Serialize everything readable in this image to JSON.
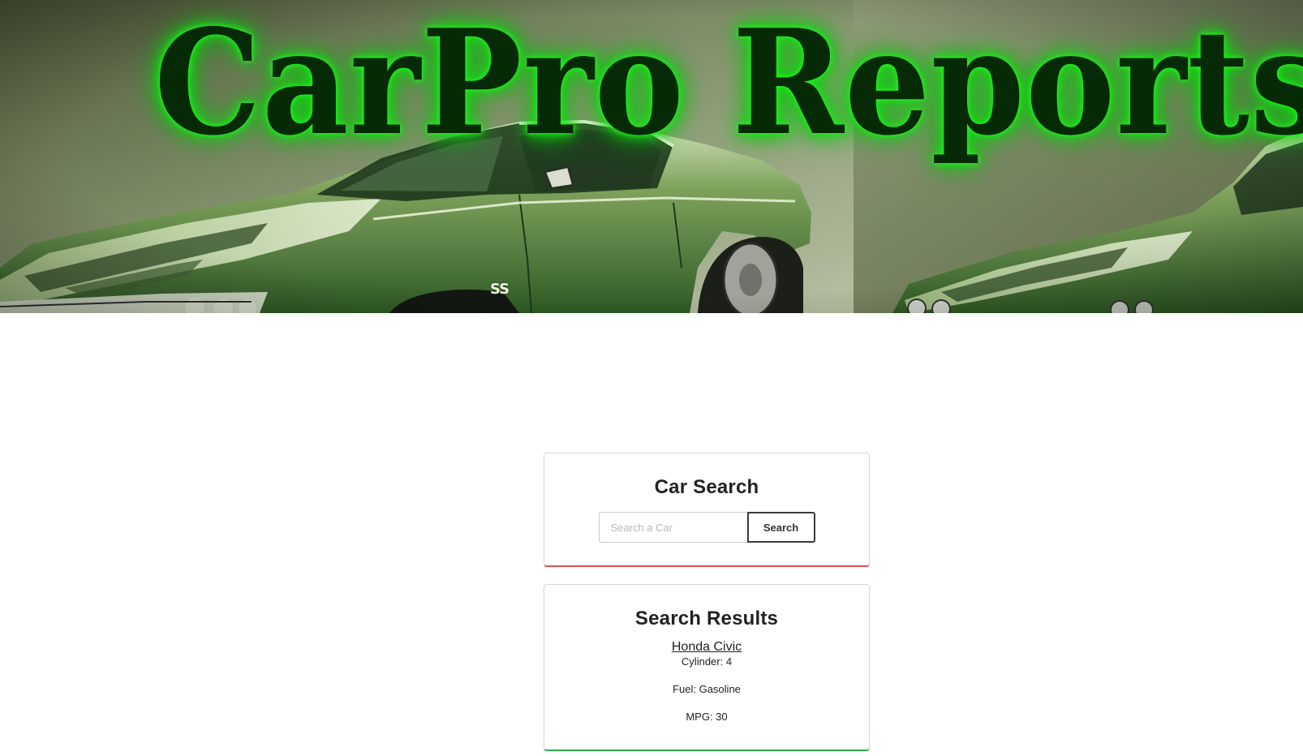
{
  "banner": {
    "title": "CarPro Reports",
    "hood_badge": "SS",
    "accent_glow": "#1fff1f",
    "title_color": "#062a06"
  },
  "search_card": {
    "title": "Car Search",
    "input_placeholder": "Search a Car",
    "input_value": "",
    "button_label": "Search",
    "accent": "#d9534f"
  },
  "results_card": {
    "title": "Search Results",
    "accent": "#2fae4f",
    "result": {
      "name": "Honda Civic",
      "cylinder": "Cylinder: 4",
      "fuel": "Fuel: Gasoline",
      "mpg": "MPG: 30"
    }
  }
}
